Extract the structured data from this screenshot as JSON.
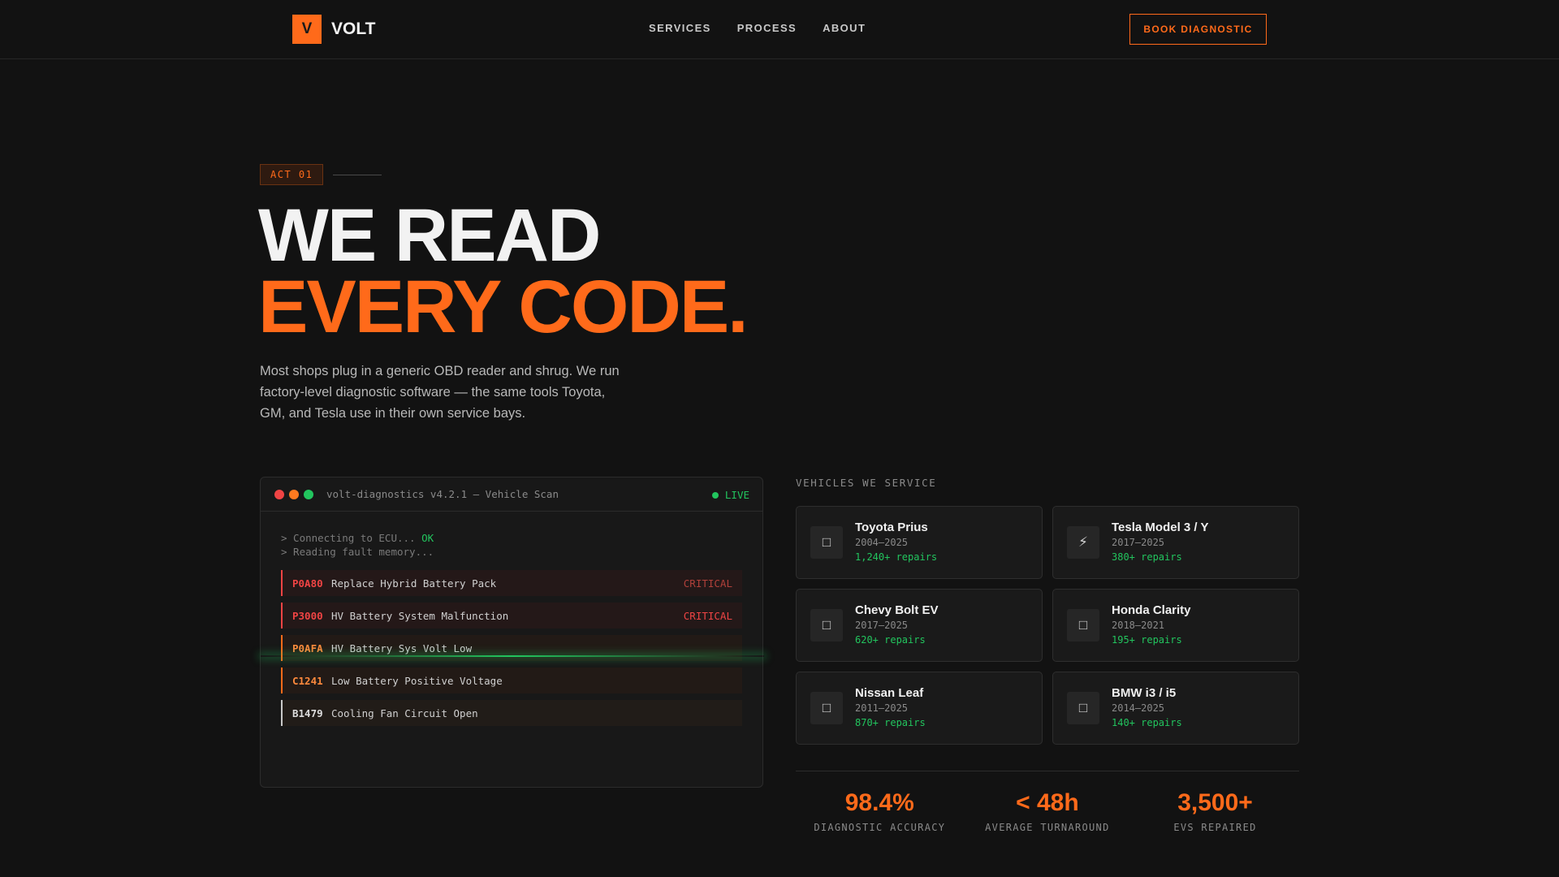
{
  "nav": {
    "logo_mark": "V",
    "logo_text": "VOLT",
    "links": [
      "SERVICES",
      "PROCESS",
      "ABOUT"
    ],
    "cta": "BOOK DIAGNOSTIC"
  },
  "hero": {
    "badge": "ACT 01",
    "line1": "WE READ",
    "line2": "EVERY CODE.",
    "subtitle": "Most shops plug in a generic OBD reader and shrug. We run factory-level diagnostic software — the same tools Toyota, GM, and Tesla use in their own service bays."
  },
  "terminal": {
    "title": "volt-diagnostics v4.2.1 — Vehicle Scan",
    "live": "LIVE",
    "log1_prefix": "> Connecting to ECU... ",
    "log1_ok": "OK",
    "log2": "> Reading fault memory...",
    "codes": [
      {
        "code": "P0A80",
        "desc": "Replace Hybrid Battery Pack",
        "severity": "CRITICAL"
      },
      {
        "code": "P3000",
        "desc": "HV Battery System Malfunction",
        "severity": "CRITICAL"
      },
      {
        "code": "P0AFA",
        "desc": "HV Battery Sys Volt Low",
        "severity": ""
      },
      {
        "code": "C1241",
        "desc": "Low Battery Positive Voltage",
        "severity": ""
      },
      {
        "code": "B1479",
        "desc": "Cooling Fan Circuit Open",
        "severity": ""
      }
    ]
  },
  "vehicles": {
    "label": "VEHICLES WE SERVICE",
    "items": [
      {
        "name": "Toyota Prius",
        "years": "2004–2025",
        "repairs": "1,240+ repairs",
        "icon": "box-icon"
      },
      {
        "name": "Tesla Model 3 / Y",
        "years": "2017–2025",
        "repairs": "380+ repairs",
        "icon": "lightning-icon"
      },
      {
        "name": "Chevy Bolt EV",
        "years": "2017–2025",
        "repairs": "620+ repairs",
        "icon": "box-icon"
      },
      {
        "name": "Honda Clarity",
        "years": "2018–2021",
        "repairs": "195+ repairs",
        "icon": "box-icon"
      },
      {
        "name": "Nissan Leaf",
        "years": "2011–2025",
        "repairs": "870+ repairs",
        "icon": "box-icon"
      },
      {
        "name": "BMW i3 / i5",
        "years": "2014–2025",
        "repairs": "140+ repairs",
        "icon": "box-icon"
      }
    ]
  },
  "stats": [
    {
      "value": "98.4%",
      "label": "DIAGNOSTIC ACCURACY"
    },
    {
      "value": "< 48h",
      "label": "AVERAGE TURNAROUND"
    },
    {
      "value": "3,500+",
      "label": "EVS REPAIRED"
    }
  ],
  "colors": {
    "accent": "#ff6a1a",
    "success": "#22c55e",
    "critical": "#ef4444",
    "background": "#121212"
  }
}
